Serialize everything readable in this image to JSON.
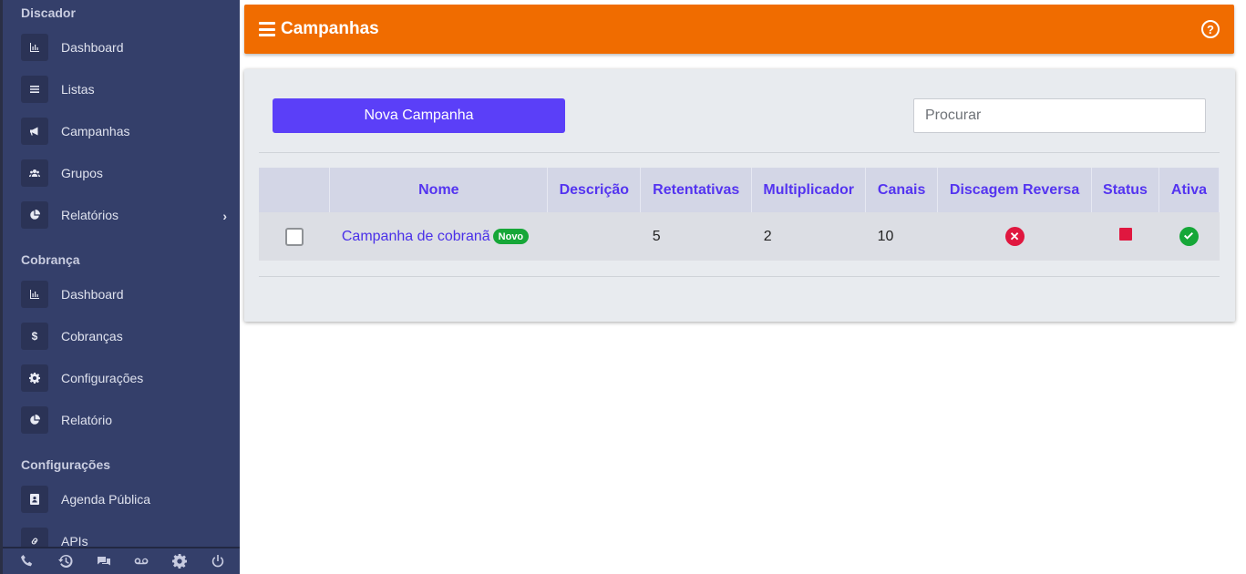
{
  "sidebar": {
    "sections": [
      {
        "title": "Discador",
        "items": [
          {
            "label": "Dashboard",
            "icon": "chart-icon"
          },
          {
            "label": "Listas",
            "icon": "list-icon"
          },
          {
            "label": "Campanhas",
            "icon": "megaphone-icon"
          },
          {
            "label": "Grupos",
            "icon": "users-icon"
          },
          {
            "label": "Relatórios",
            "icon": "pie-chart-icon",
            "has_submenu": true
          }
        ]
      },
      {
        "title": "Cobrança",
        "items": [
          {
            "label": "Dashboard",
            "icon": "chart-icon"
          },
          {
            "label": "Cobranças",
            "icon": "dollar-icon"
          },
          {
            "label": "Configurações",
            "icon": "gear-icon"
          },
          {
            "label": "Relatório",
            "icon": "pie-chart-icon"
          }
        ]
      },
      {
        "title": "Configurações",
        "items": [
          {
            "label": "Agenda Pública",
            "icon": "address-book-icon"
          },
          {
            "label": "APIs",
            "icon": "link-icon"
          }
        ]
      }
    ],
    "bottom_icons": [
      "phone-icon",
      "history-icon",
      "chat-icon",
      "voicemail-icon",
      "gear-icon",
      "power-icon"
    ]
  },
  "header": {
    "title": "Campanhas",
    "help_symbol": "?"
  },
  "toolbar": {
    "new_button_label": "Nova Campanha",
    "search_placeholder": "Procurar"
  },
  "table": {
    "columns": [
      "",
      "Nome",
      "Descrição",
      "Retentativas",
      "Multiplicador",
      "Canais",
      "Discagem Reversa",
      "Status",
      "Ativa"
    ],
    "rows": [
      {
        "checked": false,
        "name": "Campanha de cobranã",
        "badge": "Novo",
        "description": "",
        "retries": "5",
        "multiplier": "2",
        "channels": "10",
        "reverse_dial": "x-circle-icon",
        "reverse_dial_symbol": "✕",
        "status": "stop-icon",
        "active": "check-circle-icon"
      }
    ]
  },
  "colors": {
    "sidebar_bg": "#343f6a",
    "header_bg": "#f06c00",
    "primary": "#5b3ff8",
    "success": "#16a738",
    "danger": "#e0173f"
  }
}
